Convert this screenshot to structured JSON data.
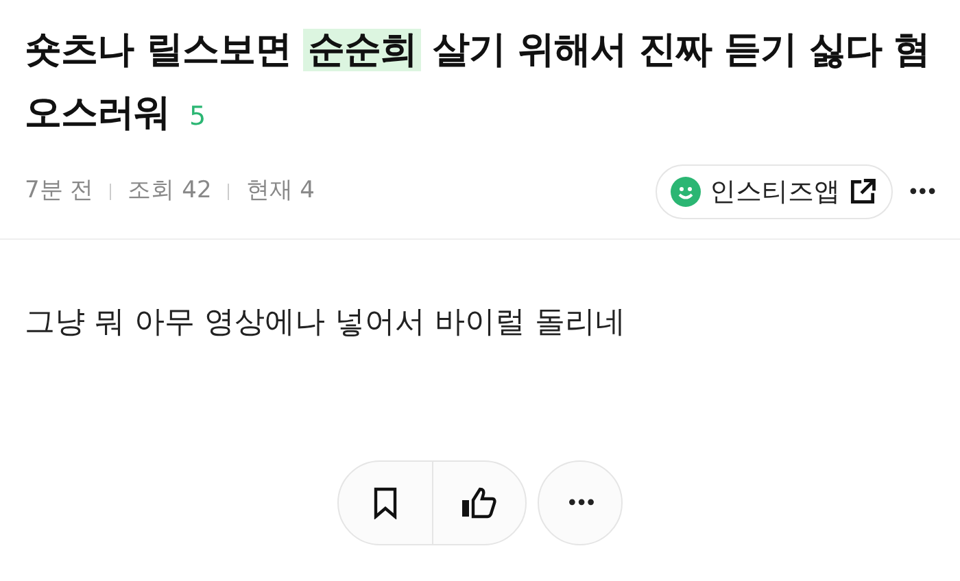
{
  "title": {
    "before": "숏츠나 릴스보면 ",
    "highlight": "순순희",
    "after": " 살기 위해서 진짜 듣기 싫다 혐오스러워"
  },
  "comment_count": "5",
  "meta": [
    "7분 전",
    "조회 42",
    "현재 4"
  ],
  "app_badge": {
    "label": "인스티즈앱"
  },
  "more_menu": "•••",
  "body": "그냥 뭐 아무 영상에나 넣어서 바이럴 돌리네",
  "actions_more": "•••"
}
